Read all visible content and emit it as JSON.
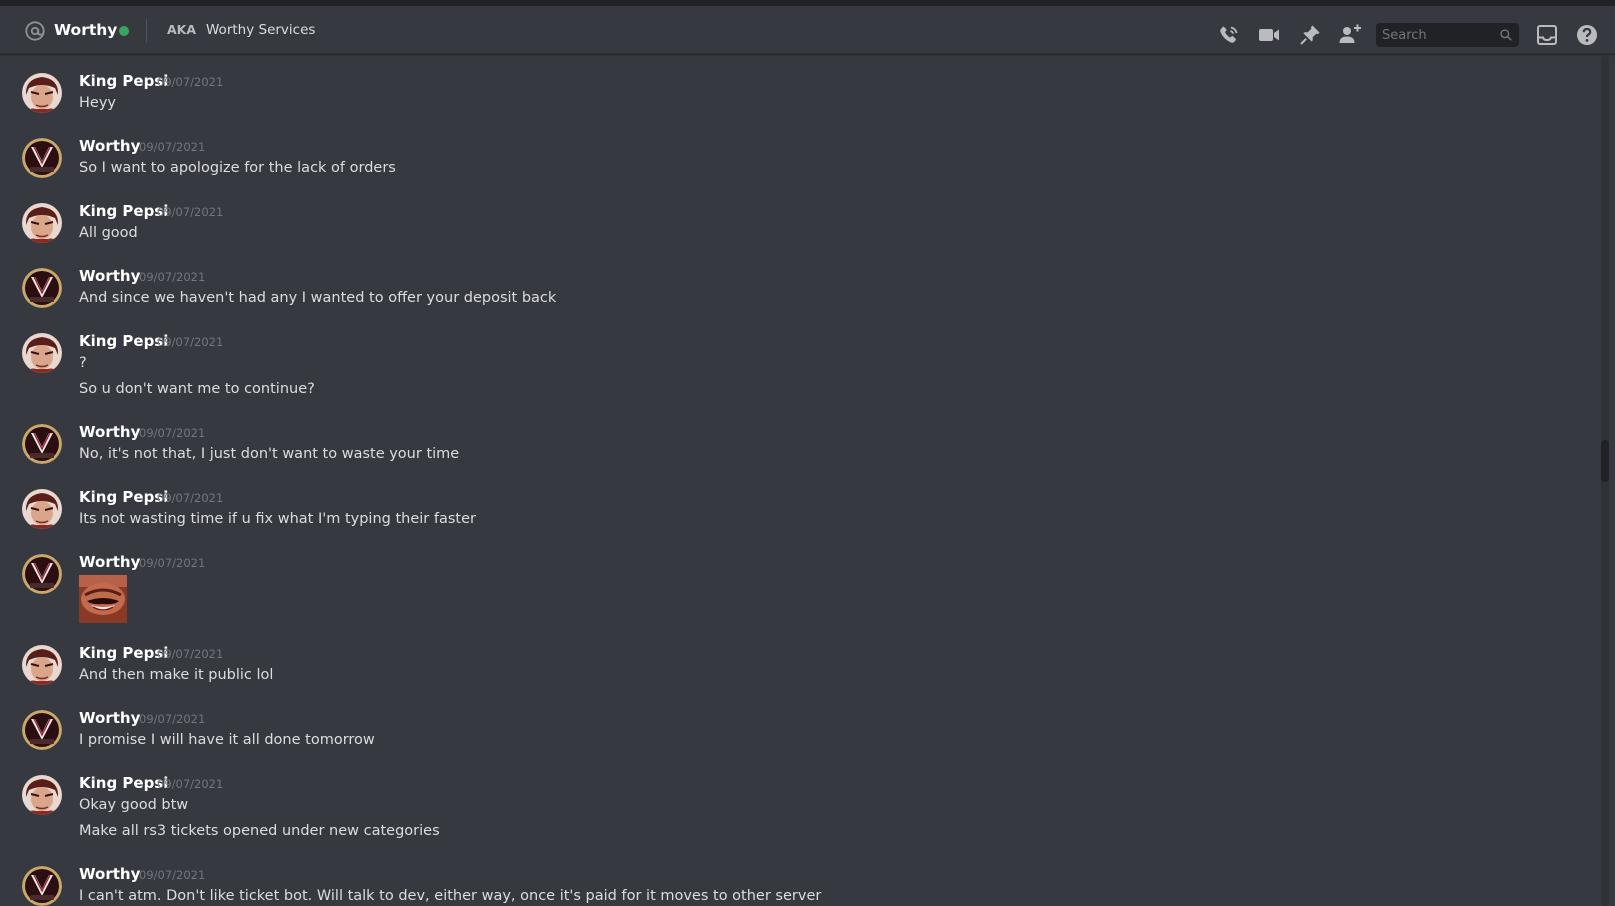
{
  "header": {
    "channel_name": "Worthy",
    "aka_label": "AKA",
    "aka_value": "Worthy Services",
    "status_color": "#3ba55d",
    "search_placeholder": "Search",
    "icons": [
      "at-icon",
      "phone-call-icon",
      "video-call-icon",
      "pin-icon",
      "add-friend-icon",
      "search-icon",
      "inbox-icon",
      "help-icon"
    ]
  },
  "messages": [
    {
      "author": "King Pepsi",
      "timestamp": "09/07/2021",
      "lines": [
        "Heyy"
      ]
    },
    {
      "author": "Worthy",
      "timestamp": "09/07/2021",
      "lines": [
        "So I want to apologize for the lack of orders"
      ]
    },
    {
      "author": "King Pepsi",
      "timestamp": "09/07/2021",
      "lines": [
        "All good"
      ]
    },
    {
      "author": "Worthy",
      "timestamp": "09/07/2021",
      "lines": [
        "And since we haven't had any I wanted to offer your deposit back"
      ]
    },
    {
      "author": "King Pepsi",
      "timestamp": "09/07/2021",
      "lines": [
        "?",
        "So u don't want me to continue?"
      ]
    },
    {
      "author": "Worthy",
      "timestamp": "09/07/2021",
      "lines": [
        "No, it's not that, I just don't want to waste your time"
      ]
    },
    {
      "author": "King Pepsi",
      "timestamp": "09/07/2021",
      "lines": [
        "Its not wasting time if u fix what I'm typing their faster"
      ]
    },
    {
      "author": "Worthy",
      "timestamp": "09/07/2021",
      "lines": [],
      "attachment": "emoji-image"
    },
    {
      "author": "King Pepsi",
      "timestamp": "09/07/2021",
      "lines": [
        "And then make it public lol"
      ]
    },
    {
      "author": "Worthy",
      "timestamp": "09/07/2021",
      "lines": [
        "I promise I will have it all done tomorrow"
      ]
    },
    {
      "author": "King Pepsi",
      "timestamp": "09/07/2021",
      "lines": [
        "Okay good btw",
        "Make all rs3 tickets opened under new categories"
      ]
    },
    {
      "author": "Worthy",
      "timestamp": "09/07/2021",
      "lines": [
        "I can't atm. Don't like ticket bot. Will talk to dev, either way, once it's paid for it moves to other server"
      ]
    }
  ]
}
